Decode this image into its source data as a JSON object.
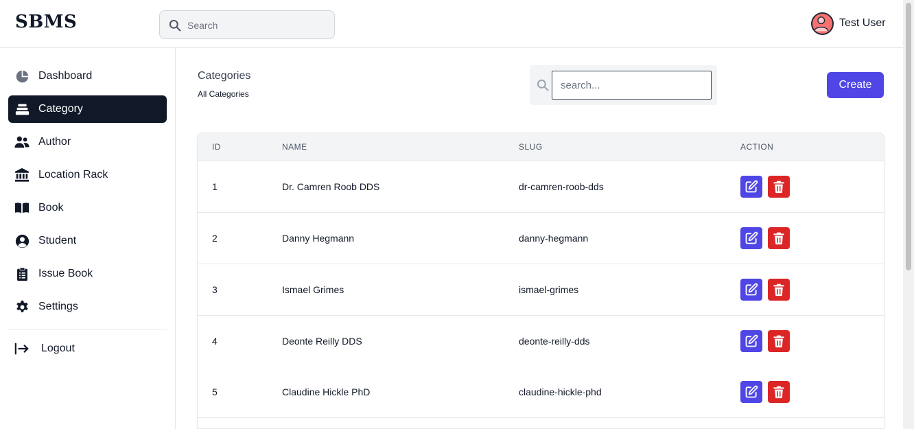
{
  "app": {
    "brand": "SBMS"
  },
  "header": {
    "search_placeholder": "Search",
    "user_name": "Test User"
  },
  "sidebar": {
    "items": [
      {
        "label": "Dashboard",
        "icon": "pie-chart-icon",
        "active": false
      },
      {
        "label": "Category",
        "icon": "layers-icon",
        "active": true
      },
      {
        "label": "Author",
        "icon": "users-icon",
        "active": false
      },
      {
        "label": "Location Rack",
        "icon": "building-icon",
        "active": false
      },
      {
        "label": "Book",
        "icon": "open-book-icon",
        "active": false
      },
      {
        "label": "Student",
        "icon": "user-circle-icon",
        "active": false
      },
      {
        "label": "Issue Book",
        "icon": "clipboard-icon",
        "active": false
      },
      {
        "label": "Settings",
        "icon": "gear-icon",
        "active": false
      }
    ],
    "logout_label": "Logout"
  },
  "main": {
    "title": "Categories",
    "subtitle": "All Categories",
    "search_placeholder": "search...",
    "create_label": "Create"
  },
  "table": {
    "headers": {
      "id": "ID",
      "name": "NAME",
      "slug": "SLUG",
      "action": "ACTION"
    },
    "rows": [
      {
        "id": "1",
        "name": "Dr. Camren Roob DDS",
        "slug": "dr-camren-roob-dds"
      },
      {
        "id": "2",
        "name": "Danny Hegmann",
        "slug": "danny-hegmann"
      },
      {
        "id": "3",
        "name": "Ismael Grimes",
        "slug": "ismael-grimes"
      },
      {
        "id": "4",
        "name": "Deonte Reilly DDS",
        "slug": "deonte-reilly-dds"
      },
      {
        "id": "5",
        "name": "Claudine Hickle PhD",
        "slug": "claudine-hickle-phd"
      }
    ]
  },
  "colors": {
    "accent": "#4f46e5",
    "danger": "#dc2626",
    "active_nav": "#111827"
  }
}
